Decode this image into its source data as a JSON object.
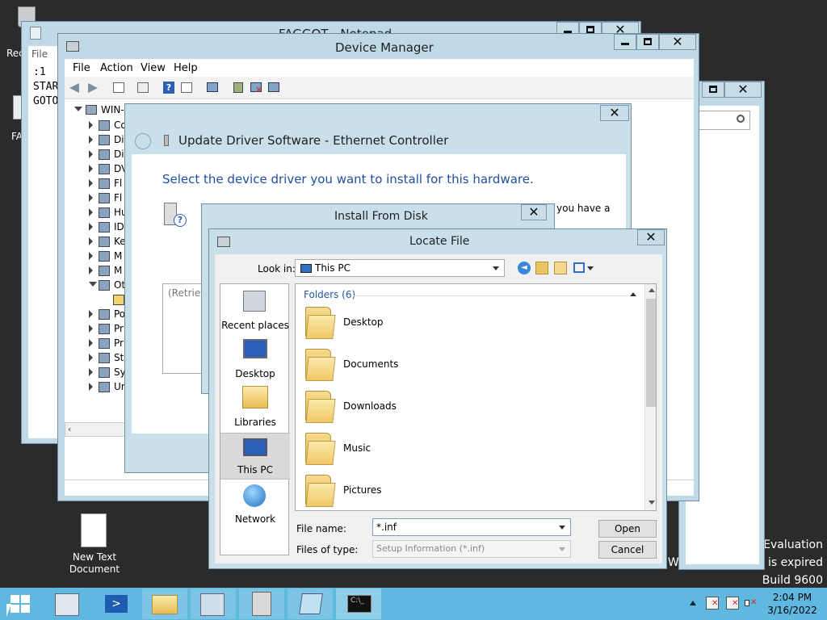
{
  "desktop": {
    "icons": [
      {
        "label": "Rec"
      },
      {
        "label": "FA"
      },
      {
        "label_line1": "New Text",
        "label_line2": "Document"
      }
    ],
    "watermark": {
      "line1": "Evaluation",
      "line2": "Windows License is expired",
      "line3": "Build 9600"
    }
  },
  "notepad": {
    "title": "FAGGOT - Notepad",
    "menu_file": "File",
    "lines": [
      ":1",
      "STAR",
      "GOTO"
    ]
  },
  "device_manager": {
    "title": "Device Manager",
    "menu": [
      "File",
      "Action",
      "View",
      "Help"
    ],
    "tree_root": "WIN-",
    "tree_items": [
      "Co",
      "Di",
      "Di",
      "DV",
      "Fl",
      "Fl",
      "Hu",
      "ID",
      "Ke",
      "M",
      "M",
      "Ot",
      "",
      "Po",
      "Pr",
      "Pr",
      "St",
      "Sy",
      "Ur"
    ]
  },
  "update_driver": {
    "title": "Update Driver Software - Ethernet Controller",
    "heading": "Select the device driver you want to install for this hardware.",
    "right_text": "you have a",
    "retrieving": "(Retrievi"
  },
  "install_from_disk": {
    "title": "Install From Disk"
  },
  "locate_file": {
    "title": "Locate File",
    "look_in_label": "Look in:",
    "look_in_value": "This PC",
    "group_header": "Folders (6)",
    "places": [
      "Recent places",
      "Desktop",
      "Libraries",
      "This PC",
      "Network"
    ],
    "folders": [
      "Desktop",
      "Documents",
      "Downloads",
      "Music",
      "Pictures"
    ],
    "file_name_label": "File name:",
    "file_name_value": "*.inf",
    "file_type_label": "Files of type:",
    "file_type_value": "Setup Information (*.inf)",
    "open_button": "Open",
    "cancel_button": "Cancel"
  },
  "taskbar": {
    "time": "2:04 PM",
    "date": "3/16/2022"
  },
  "colors": {
    "taskbar": "#5fb8e0",
    "accent_blue": "#1e4fa0",
    "window_frame": "#bfd9e6"
  }
}
